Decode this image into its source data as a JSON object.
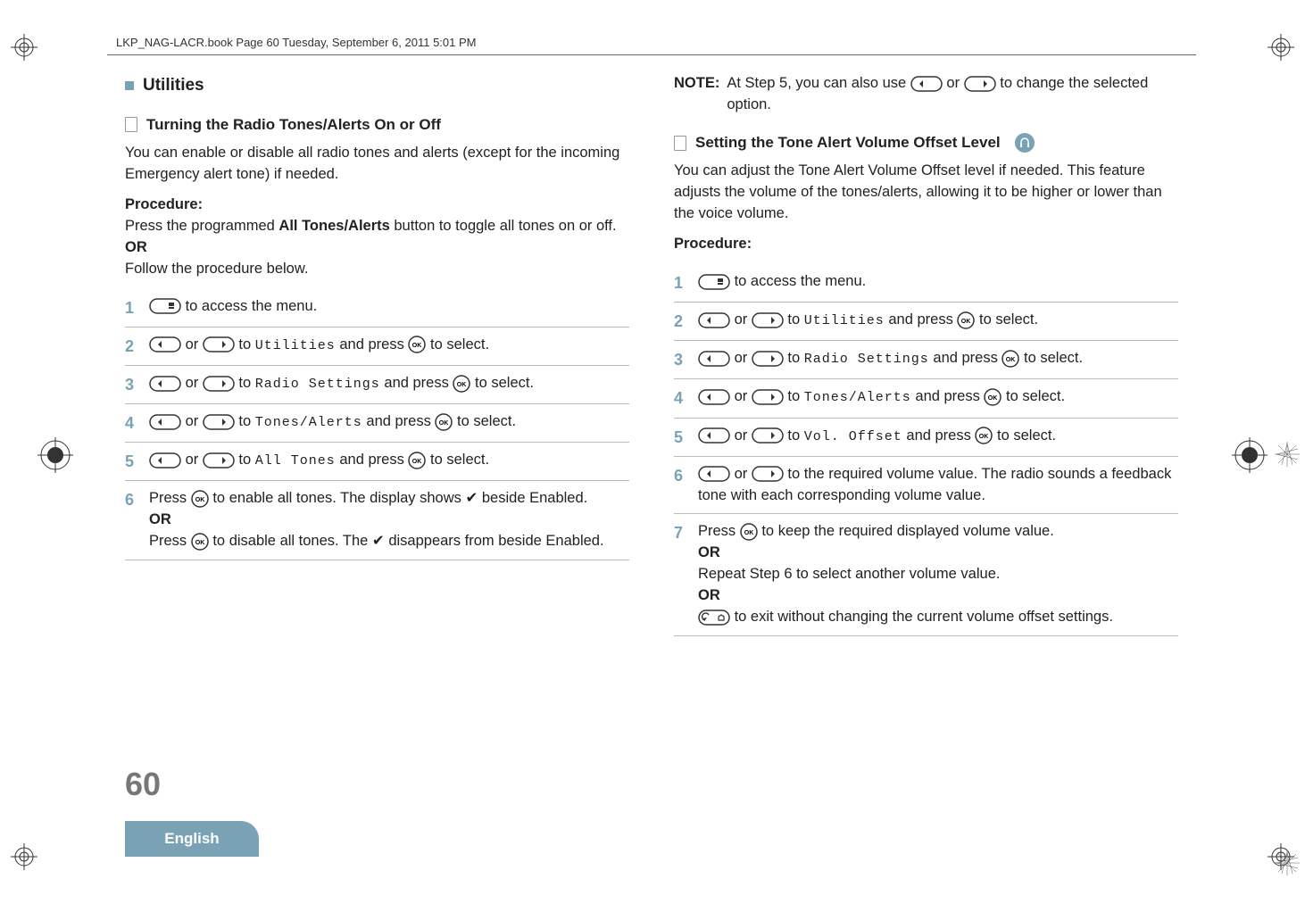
{
  "header": "LKP_NAG-LACR.book  Page 60  Tuesday, September 6, 2011  5:01 PM",
  "section_title": "Utilities",
  "left": {
    "sub_title": "Turning the Radio Tones/Alerts On or Off",
    "intro": "You can enable or disable all radio tones and alerts (except for the incoming Emergency alert tone) if needed.",
    "procedure_label": "Procedure:",
    "proc_line1_a": "Press the programmed ",
    "proc_line1_bold": "All Tones/Alerts",
    "proc_line1_b": " button to toggle all tones on or off.",
    "or": "OR",
    "proc_line2": "Follow the procedure below.",
    "steps": {
      "s1": " to access the menu.",
      "s2_a": " or ",
      "s2_b": " to ",
      "s2_mono": "Utilities",
      "s2_c": " and press ",
      "s2_d": " to select.",
      "s3_a": " or ",
      "s3_b": " to ",
      "s3_mono": "Radio Settings",
      "s3_c": " and press ",
      "s3_d": " to select.",
      "s4_a": " or ",
      "s4_b": " to ",
      "s4_mono": "Tones/Alerts",
      "s4_c": " and press ",
      "s4_d": " to select.",
      "s5_a": " or ",
      "s5_b": " to ",
      "s5_mono": "All Tones",
      "s5_c": " and press ",
      "s5_d": " to select.",
      "s6_a": "Press ",
      "s6_b": " to enable all tones. The display shows ✔ beside Enabled.",
      "s6_or": "OR",
      "s6_c": "Press ",
      "s6_d": " to disable all tones. The ✔ disappears from beside Enabled."
    }
  },
  "right": {
    "note_label": "NOTE:",
    "note_a": "At Step 5, you can also use ",
    "note_b": " or ",
    "note_c": " to change the selected option.",
    "sub_title": "Setting the Tone Alert Volume Offset Level",
    "intro": "You can adjust the Tone Alert Volume Offset level if needed. This feature adjusts the volume of the tones/alerts, allowing it to be higher or lower than the voice volume.",
    "procedure_label": "Procedure:",
    "steps": {
      "s1": " to access the menu.",
      "s2_a": " or ",
      "s2_b": " to ",
      "s2_mono": "Utilities",
      "s2_c": " and press ",
      "s2_d": " to select.",
      "s3_a": " or ",
      "s3_b": " to ",
      "s3_mono": "Radio Settings",
      "s3_c": " and press ",
      "s3_d": " to select.",
      "s4_a": " or ",
      "s4_b": " to ",
      "s4_mono": "Tones/Alerts",
      "s4_c": " and press ",
      "s4_d": " to select.",
      "s5_a": " or ",
      "s5_b": " to ",
      "s5_mono": "Vol. Offset",
      "s5_c": " and press ",
      "s5_d": " to select.",
      "s6_a": " or ",
      "s6_b": " to the required volume value. The radio sounds a feedback tone with each corresponding volume value.",
      "s7_a": "Press ",
      "s7_b": " to keep the required displayed volume value.",
      "s7_or1": "OR",
      "s7_c": "Repeat Step 6 to select another volume value.",
      "s7_or2": "OR",
      "s7_d": " to exit without changing the current volume offset settings."
    }
  },
  "page_number": "60",
  "lang": "English",
  "nums": {
    "n1": "1",
    "n2": "2",
    "n3": "3",
    "n4": "4",
    "n5": "5",
    "n6": "6",
    "n7": "7"
  }
}
